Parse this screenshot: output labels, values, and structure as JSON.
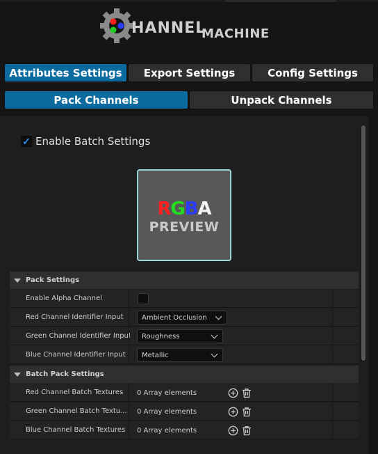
{
  "logo": {
    "brand_left": "HANNEL",
    "brand_right": "MACHINE"
  },
  "tabs_primary": [
    {
      "label": "Attributes Settings",
      "active": true
    },
    {
      "label": "Export Settings",
      "active": false
    },
    {
      "label": "Config Settings",
      "active": false
    }
  ],
  "tabs_secondary": [
    {
      "label": "Pack Channels",
      "active": true
    },
    {
      "label": "Unpack Channels",
      "active": false
    }
  ],
  "batch": {
    "label": "Enable Batch Settings",
    "checked": true
  },
  "preview": {
    "r": "R",
    "g": "G",
    "b": "B",
    "a": "A",
    "word": "PREVIEW"
  },
  "pack_settings": {
    "title": "Pack Settings",
    "rows": [
      {
        "label": "Enable Alpha Channel",
        "type": "checkbox",
        "checked": false
      },
      {
        "label": "Red Channel Identifier Input",
        "type": "dropdown",
        "value": "Ambient Occlusion"
      },
      {
        "label": "Green Channel Identifier Input",
        "type": "dropdown",
        "value": "Roughness"
      },
      {
        "label": "Blue Channel Identifier Input",
        "type": "dropdown",
        "value": "Metallic"
      }
    ]
  },
  "batch_pack_settings": {
    "title": "Batch Pack Settings",
    "rows": [
      {
        "label": "Red Channel Batch Textures",
        "value": "0 Array elements"
      },
      {
        "label": "Green Channel Batch Textu...",
        "value": "0 Array elements"
      },
      {
        "label": "Blue Channel Batch Textures",
        "value": "0 Array elements"
      }
    ]
  },
  "colors": {
    "accent": "#0b6a9e",
    "check": "#2f8ff0",
    "preview_border": "#9ad7d6"
  },
  "icons": [
    "gear-logo-icon",
    "checkmark-icon",
    "collapse-arrow-icon",
    "chevron-down-icon",
    "add-circle-icon",
    "trash-icon"
  ]
}
